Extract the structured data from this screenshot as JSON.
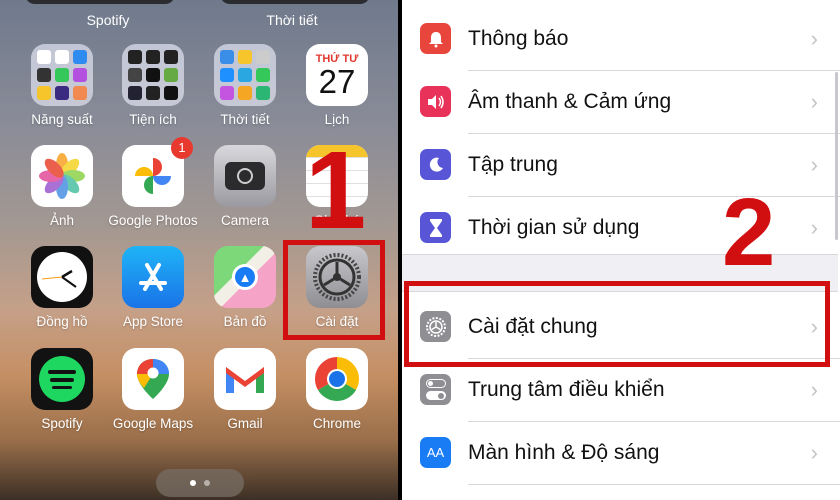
{
  "home_screen": {
    "widget_labels": [
      "Spotify",
      "Thời tiết"
    ],
    "apps": [
      {
        "name": "Năng suất",
        "type": "folder"
      },
      {
        "name": "Tiện ích",
        "type": "folder"
      },
      {
        "name": "Thời tiết",
        "type": "folder"
      },
      {
        "name": "Lịch",
        "type": "calendar",
        "weekday": "THỨ TƯ",
        "day": "27"
      },
      {
        "name": "Ảnh",
        "type": "photos"
      },
      {
        "name": "Google Photos",
        "type": "google-photos",
        "badge": "1"
      },
      {
        "name": "Camera",
        "type": "camera"
      },
      {
        "name": "Ghi chú",
        "type": "notes"
      },
      {
        "name": "Đồng hồ",
        "type": "clock"
      },
      {
        "name": "App Store",
        "type": "app-store"
      },
      {
        "name": "Bản đồ",
        "type": "maps"
      },
      {
        "name": "Cài đặt",
        "type": "settings"
      },
      {
        "name": "Spotify",
        "type": "spotify"
      },
      {
        "name": "Google Maps",
        "type": "google-maps"
      },
      {
        "name": "Gmail",
        "type": "gmail"
      },
      {
        "name": "Chrome",
        "type": "chrome"
      }
    ],
    "page_count": 2,
    "current_page": 1,
    "step_label": "1"
  },
  "settings": {
    "items": [
      {
        "label": "Thông báo",
        "icon": "bell-icon",
        "color": "#e8453c"
      },
      {
        "label": "Âm thanh & Cảm ứng",
        "icon": "speaker-icon",
        "color": "#e8325a"
      },
      {
        "label": "Tập trung",
        "icon": "moon-icon",
        "color": "#5856d6"
      },
      {
        "label": "Thời gian sử dụng",
        "icon": "hourglass-icon",
        "color": "#5856d6"
      },
      {
        "label": "Cài đặt chung",
        "icon": "gear-icon",
        "color": "#8e8e93"
      },
      {
        "label": "Trung tâm điều khiển",
        "icon": "toggles-icon",
        "color": "#8e8e93"
      },
      {
        "label": "Màn hình & Độ sáng",
        "icon": "text-size-icon",
        "color": "#1a7cf5",
        "glyph": "AA"
      }
    ],
    "chevron": "›",
    "step_label": "2"
  },
  "colors": {
    "highlight": "#d20f10"
  }
}
